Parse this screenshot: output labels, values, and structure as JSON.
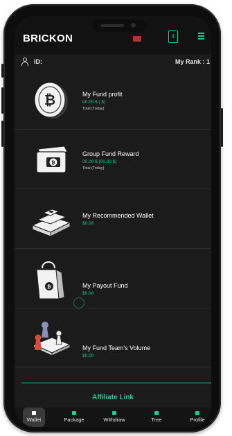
{
  "header": {
    "brand": "BRICKON",
    "cart_count": "4",
    "id_label": "ID:",
    "rank_label": "My Rank : 1"
  },
  "cards": [
    {
      "title": "My Fund profit",
      "amount": "00.00 $ ( $)",
      "sub": "Total (Today)",
      "icon": "bitcoin-coin-icon"
    },
    {
      "title": "Group Fund Reward",
      "amount": "00.00 $ (00.00 $)",
      "sub": "Total (Today)",
      "icon": "bitcoin-wallet-icon"
    },
    {
      "title": "My Recommended Wallet",
      "amount": "$0.00",
      "icon": "money-stack-icon"
    },
    {
      "title": "My Payout Fund",
      "amount": "$0.00",
      "icon": "shopping-bag-icon"
    },
    {
      "title": "My Fund Team's Volume",
      "amount": "$0.00",
      "icon": "team-pawns-icon"
    }
  ],
  "affiliate_label": "Affiliate Link",
  "nav": [
    {
      "label": "Wallet",
      "icon": "wallet-icon",
      "active": true
    },
    {
      "label": "Package",
      "icon": "package-icon"
    },
    {
      "label": "Withdraw",
      "icon": "withdraw-icon"
    },
    {
      "label": "Tree",
      "icon": "tree-icon"
    },
    {
      "label": "Profile",
      "icon": "profile-icon"
    }
  ],
  "colors": {
    "accent": "#20c997",
    "background": "#1b1b1b",
    "text": "#ffffff"
  }
}
